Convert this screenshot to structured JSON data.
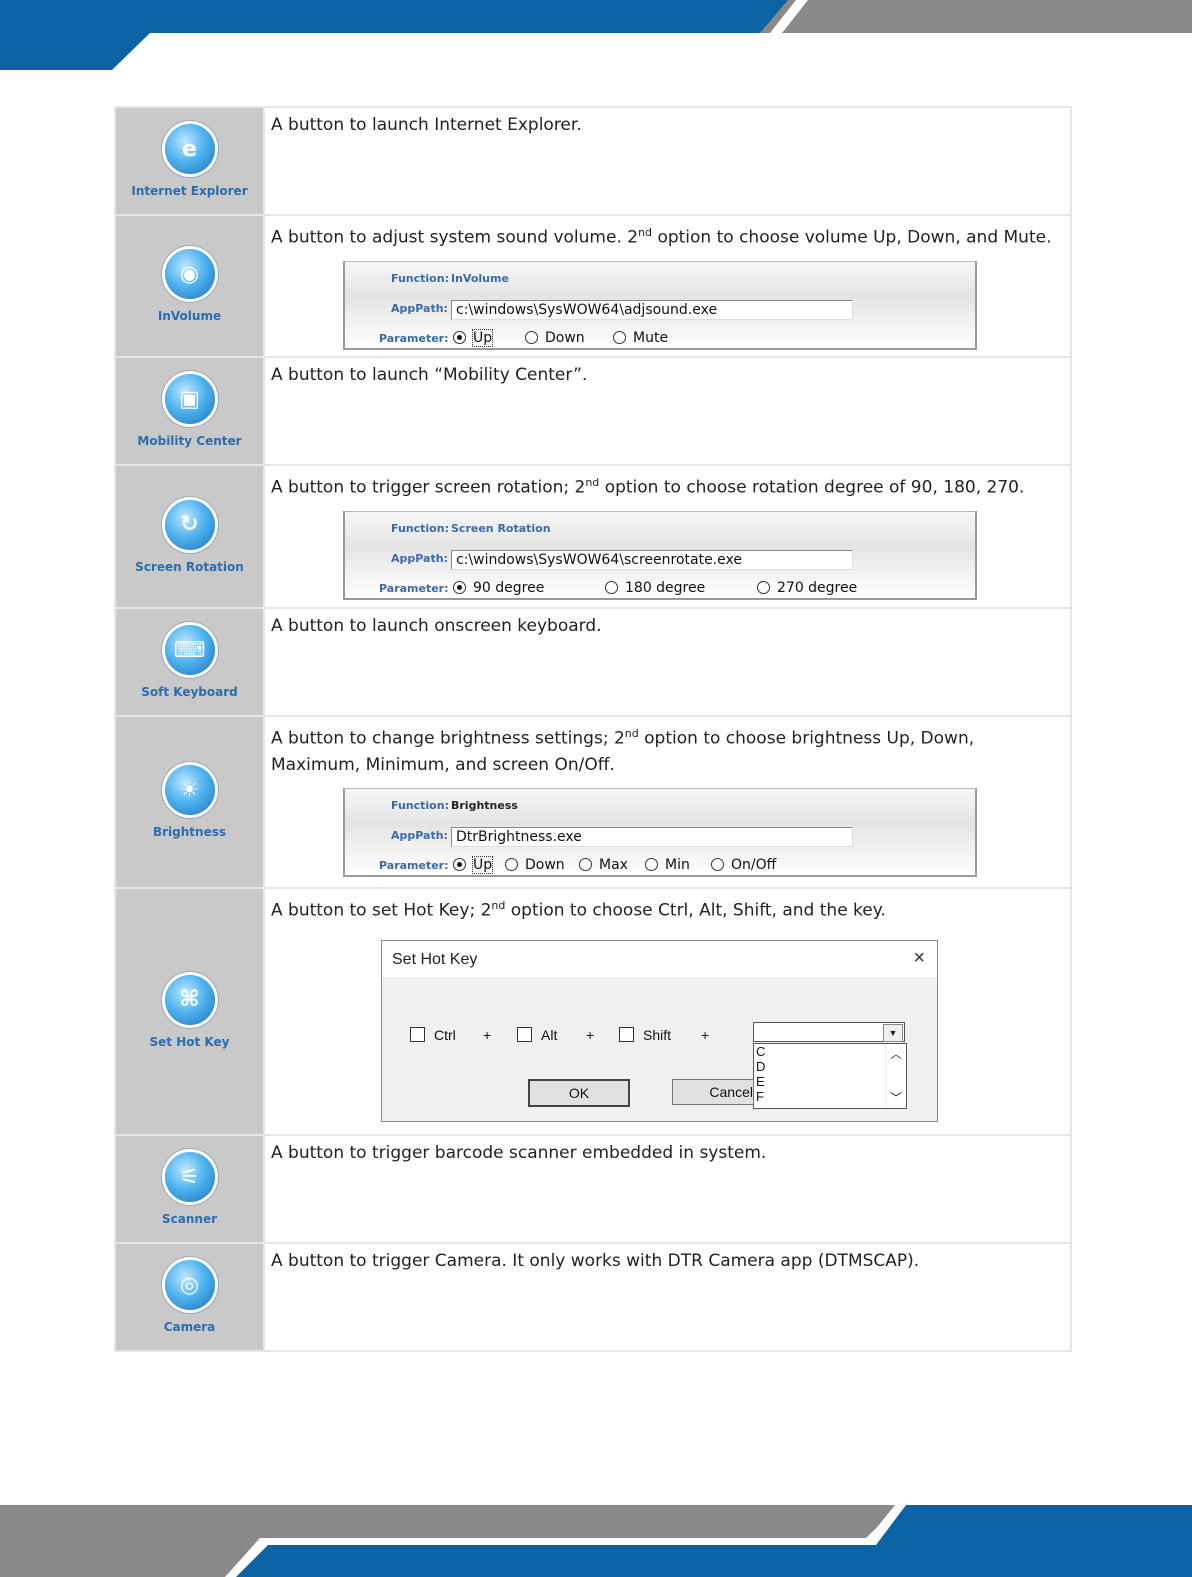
{
  "colors": {
    "accent_blue": "#0c63a3",
    "band_gray": "#8a8a8a",
    "icon_cell": "#c9c9c9",
    "label_blue": "#2a6db0"
  },
  "rows": [
    {
      "icon": "internet-explorer-icon",
      "label": "Internet Explorer",
      "glyph": "e",
      "desc": "A button to launch Internet Explorer."
    },
    {
      "icon": "volume-icon",
      "label": "InVolume",
      "glyph": "◉",
      "desc_pre": "A button to adjust system sound volume. 2",
      "desc_sup": "nd",
      "desc_post": " option to choose volume Up, Down, and Mute.",
      "panel": {
        "function_label": "Function:",
        "function_value": "InVolume",
        "apppath_label": "AppPath:",
        "apppath_value": "c:\\windows\\SysWOW64\\adjsound.exe",
        "parameter_label": "Parameter:",
        "options": [
          "Up",
          "Down",
          "Mute"
        ],
        "selected": "Up"
      }
    },
    {
      "icon": "mobility-center-icon",
      "label": "Mobility Center",
      "glyph": "▣",
      "desc": "A button to launch “Mobility Center”."
    },
    {
      "icon": "screen-rotation-icon",
      "label": "Screen Rotation",
      "glyph": "↻",
      "desc_pre": "A button to trigger screen rotation; 2",
      "desc_sup": "nd",
      "desc_post": " option to choose rotation degree of 90, 180, 270.",
      "panel": {
        "function_label": "Function:",
        "function_value": "Screen Rotation",
        "apppath_label": "AppPath:",
        "apppath_value": "c:\\windows\\SysWOW64\\screenrotate.exe",
        "parameter_label": "Parameter:",
        "options": [
          "90 degree",
          "180 degree",
          "270 degree"
        ],
        "selected": "90 degree"
      }
    },
    {
      "icon": "keyboard-icon",
      "label": "Soft Keyboard",
      "glyph": "⌨",
      "desc": "A button to launch onscreen keyboard."
    },
    {
      "icon": "brightness-icon",
      "label": "Brightness",
      "glyph": "☀",
      "desc_pre": "A button to change brightness settings; 2",
      "desc_sup": "nd",
      "desc_post": " option to choose brightness Up, Down, Maximum, Minimum, and screen On/Off.",
      "panel": {
        "function_label": "Function:",
        "function_value": "Brightness",
        "apppath_label": "AppPath:",
        "apppath_value": "DtrBrightness.exe",
        "parameter_label": "Parameter:",
        "options": [
          "Up",
          "Down",
          "Max",
          "Min",
          "On/Off"
        ],
        "selected": "Up"
      }
    },
    {
      "icon": "hot-key-icon",
      "label": "Set Hot Key",
      "glyph": "⌘",
      "desc_pre": "A button to set Hot Key; 2",
      "desc_sup": "nd",
      "desc_post": " option to choose Ctrl, Alt, Shift, and the key.",
      "dialog": {
        "title": "Set Hot Key",
        "close": "×",
        "checks": [
          "Ctrl",
          "Alt",
          "Shift"
        ],
        "plus": "+",
        "list_options": [
          "C",
          "D",
          "E",
          "F"
        ],
        "ok": "OK",
        "cancel": "Cancel"
      }
    },
    {
      "icon": "scanner-icon",
      "label": "Scanner",
      "glyph": "⚟",
      "desc": "A button to trigger barcode scanner embedded in system."
    },
    {
      "icon": "camera-icon",
      "label": "Camera",
      "glyph": "◎",
      "desc": "A button to trigger Camera. It only works with DTR Camera app (DTMSCAP)."
    }
  ]
}
